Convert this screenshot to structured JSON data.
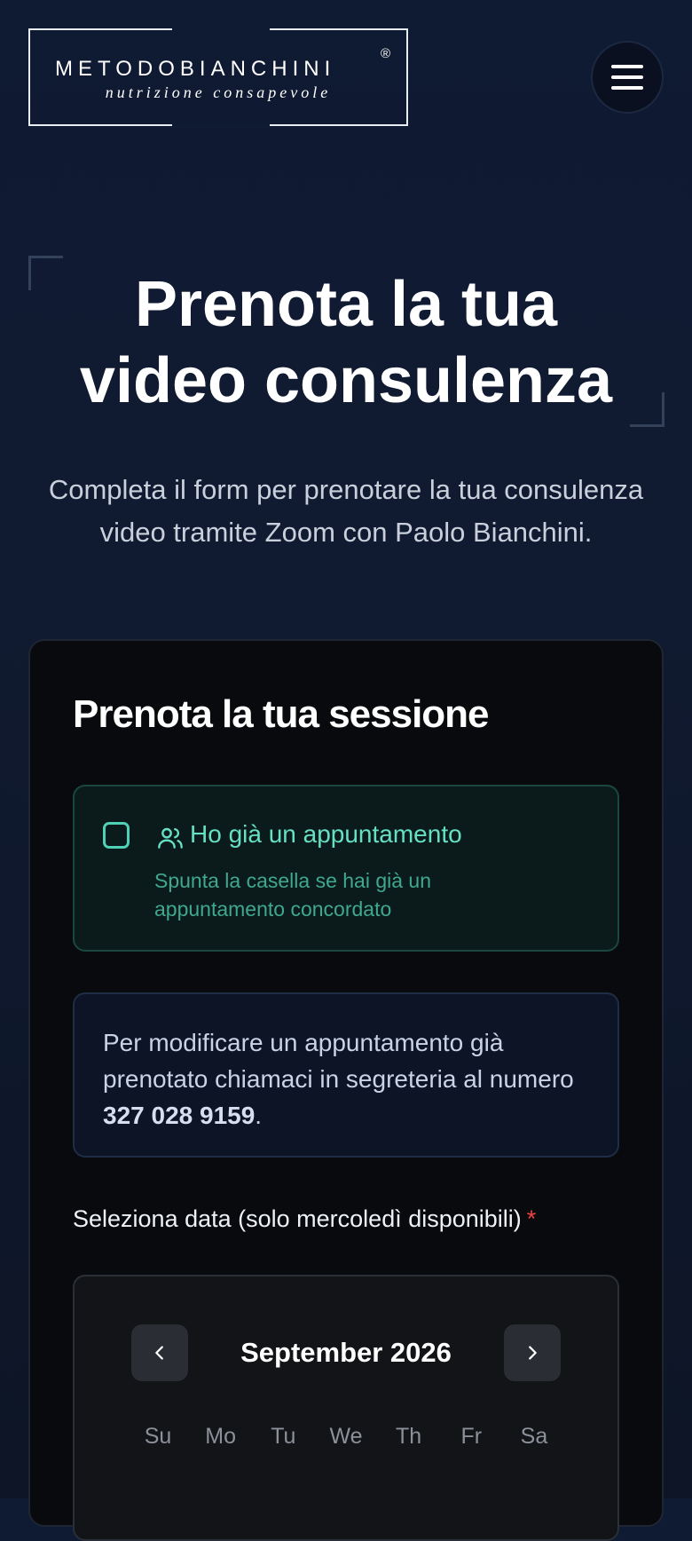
{
  "header": {
    "logo_main": "METODOBIANCHINI",
    "logo_reg": "®",
    "logo_sub": "nutrizione consapevole",
    "menu_icon": "hamburger-menu-icon"
  },
  "hero": {
    "title_line1": "Prenota la tua",
    "title_line2": "video consulenza",
    "subtitle_line1": "Completa il form per prenotare la tua consulenza",
    "subtitle_line2": "video tramite Zoom con Paolo Bianchini."
  },
  "form": {
    "title": "Prenota la tua sessione",
    "existing": {
      "checked": false,
      "icon": "users-icon",
      "label": "Ho già un appuntamento",
      "help": "Spunta la casella se hai già un appuntamento concordato"
    },
    "info": {
      "text": "Per modificare un appuntamento già prenotato chiamaci in segreteria al numero ",
      "phone": "327 028 9159",
      "suffix": "."
    },
    "date_label": "Seleziona data (solo mercoledì disponibili)",
    "required_mark": "*",
    "calendar": {
      "month": "September 2026",
      "prev_icon": "chevron-left-icon",
      "next_icon": "chevron-right-icon",
      "weekdays": [
        "Su",
        "Mo",
        "Tu",
        "We",
        "Th",
        "Fr",
        "Sa"
      ]
    }
  },
  "colors": {
    "accent_teal": "#66e0c4",
    "background": "#0f1a33",
    "required": "#ef4444"
  }
}
